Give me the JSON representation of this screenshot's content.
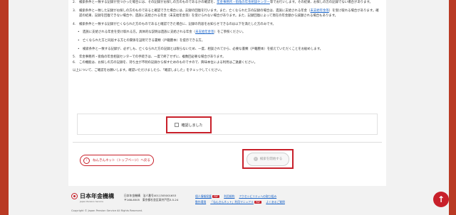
{
  "content": {
    "items": [
      {
        "num": "2.",
        "text_before": "検索条件と一致する記録が見つかった場合には、その記録がお探しの方のものであるかの確認を、",
        "link": "年金事務所・街角の年金相談センター",
        "text_after": "等でお行いします。その結果、お探しの方の記録でない場合があります。"
      },
      {
        "num": "3.",
        "text_before": "検索条件と一致した記録がお探しの方のものであると確認できた場合には、記録の回復を行います。また、亡くなられた方の記録の場合は、遺族に支給される年金（",
        "link": "未支給年金等",
        "text_after": "）を受け取れる場合があります。確認の結果、記録を回復できない場合や、遺族に支給される年金（未支給年金等）を受けられない場合があります。また、記録回復によって現在の年金額から減額される場合もあります。"
      },
      {
        "num": "4.",
        "text_before": "検索条件と一致する記録が亡くなられた方のものであると確認できた場合に、記録の内容をお知らせできるのは以下を満たした方のみです。",
        "link": "",
        "text_after": ""
      }
    ],
    "sub_items": [
      {
        "text_before": "遺族に支給される年金を受け取れる方。具体的な説明は遺族に支給される年金（",
        "link": "未支給年金等",
        "text_after": "）をご参照ください。"
      },
      {
        "text_before": "亡くなられた方と同居する方との関係を証明できる書類（戸籍謄本）を提示できる方。",
        "link": "",
        "text_after": ""
      },
      {
        "text_before": "検索条件と一致する記録が、必ずしも、亡くなられた方の記録とは限らないため、一度、相談されてから、必要な書類（戸籍謄本）を揃えていただくことをお勧めします。",
        "link": "",
        "text_after": ""
      }
    ],
    "items2": [
      {
        "num": "5.",
        "text": "年金事務所・街角の年金相談センターでの手続きは、一度で終了せずに、複数回必要な場合があります。"
      },
      {
        "num": "6.",
        "text": "この機能は、お探しの方の記録を、持ち主が不明の記録から探すためのものですので、興味本位による利用はご遠慮ください。"
      }
    ],
    "closing": "以上について、ご確認をお願いします。確認いただけましたら、「確認しました」をチェックしてください。"
  },
  "confirm": {
    "label": "確認しました",
    "checked": false
  },
  "buttons": {
    "back": "ねんきんネット（トップページ）へ戻る",
    "start": "検索を開始する"
  },
  "footer": {
    "logo": "日本年金機構",
    "logo_sub": "Japan Pension Service",
    "addr_line1": "日本年金機構　法人番号4011305001653",
    "addr_line2": "〒168-8505　東京都杉並区高井戸西3-5-24",
    "links": [
      [
        "個人情報保護",
        "利用規約",
        "アクセシビリティへの取り組み"
      ],
      [
        "動作環境",
        "「ねんきんネット」利用マニュアル",
        "よくあるご質問"
      ]
    ],
    "tags": [
      "PDF",
      "PDF"
    ],
    "copyright": "Copyright © Japan Pension Service All Rights Reserved."
  },
  "colors": {
    "accent": "#c8202a",
    "link": "#1a64c8",
    "frame": "#b93a24"
  },
  "icons": {
    "to_top": "arrow-up-icon"
  }
}
